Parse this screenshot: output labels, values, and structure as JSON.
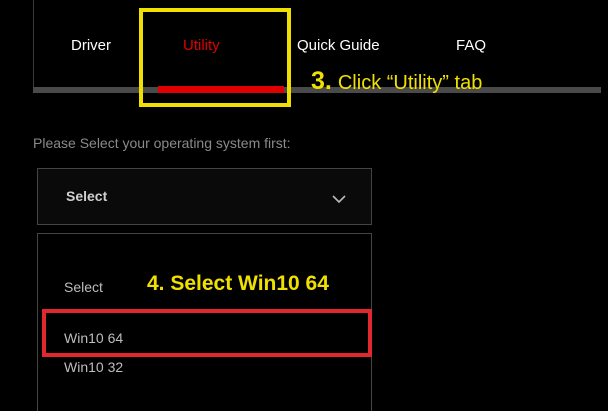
{
  "tabs": [
    {
      "label": "Driver"
    },
    {
      "label": "Utility",
      "active": true
    },
    {
      "label": "Quick Guide"
    },
    {
      "label": "FAQ"
    }
  ],
  "annotations": {
    "step3_number": "3.",
    "step3_text": "Click “Utility” tab",
    "step4_text": "4. Select Win10 64"
  },
  "os_selector": {
    "prompt": "Please Select your operating system first:",
    "selected_value": "Select",
    "options": [
      "Select",
      "Win10 64",
      "Win10 32"
    ]
  },
  "colors": {
    "active_tab": "#e00000",
    "annotation_yellow": "#f0e000",
    "annotation_red": "#e0282e"
  }
}
